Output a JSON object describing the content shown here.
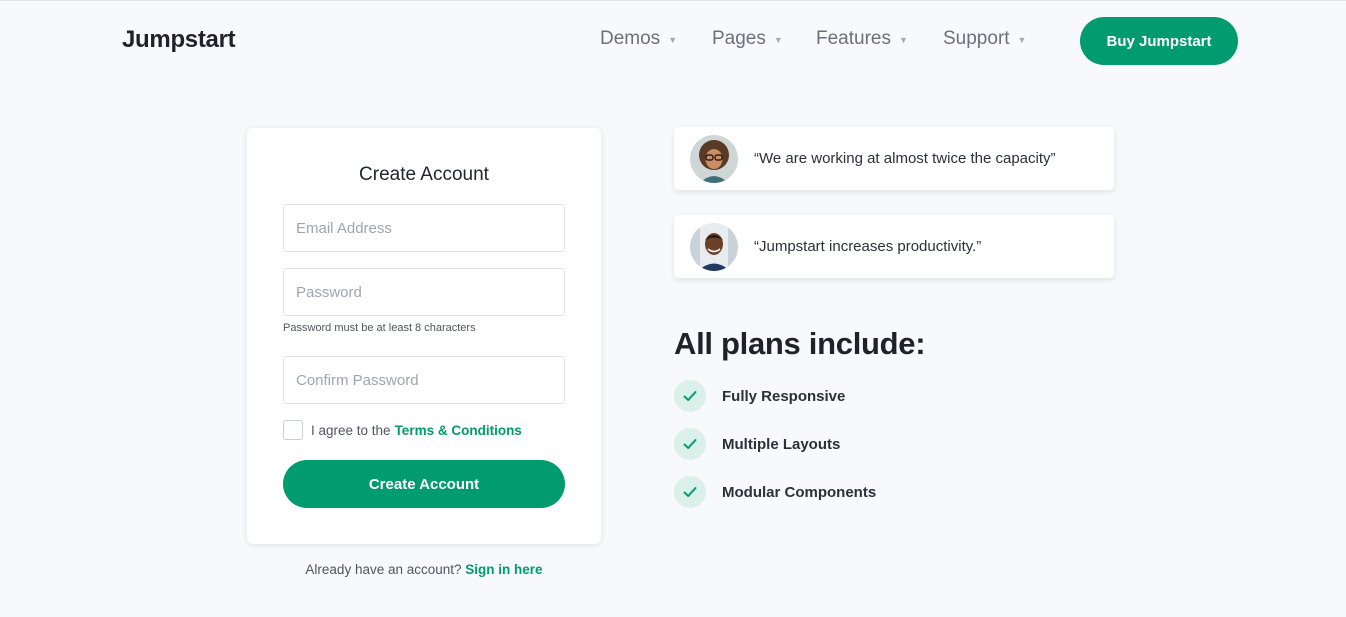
{
  "header": {
    "logo": "Jumpstart",
    "nav": [
      {
        "label": "Demos"
      },
      {
        "label": "Pages"
      },
      {
        "label": "Features"
      },
      {
        "label": "Support"
      }
    ],
    "caret_glyph": "▼",
    "cta_label": "Buy Jumpstart"
  },
  "form": {
    "title": "Create Account",
    "email_placeholder": "Email Address",
    "password_placeholder": "Password",
    "password_hint": "Password must be at least 8 characters",
    "confirm_placeholder": "Confirm Password",
    "agree_prefix": "I agree to the",
    "terms_link": "Terms & Conditions",
    "submit_label": "Create Account",
    "signin_prefix": "Already have an account?",
    "signin_link": "Sign in here"
  },
  "testimonials": [
    {
      "quote": "“We are working at almost twice the capacity”",
      "avatar_icon": "user-avatar-woman"
    },
    {
      "quote": "“Jumpstart increases productivity.”",
      "avatar_icon": "user-avatar-man"
    }
  ],
  "plans": {
    "title": "All plans include:",
    "features": [
      {
        "label": "Fully Responsive",
        "icon": "check-icon"
      },
      {
        "label": "Multiple Layouts",
        "icon": "check-icon"
      },
      {
        "label": "Modular Components",
        "icon": "check-icon"
      }
    ]
  },
  "colors": {
    "brand": "#009b6e",
    "background": "#f7f9fc",
    "check_bg": "#dcf0ea"
  }
}
